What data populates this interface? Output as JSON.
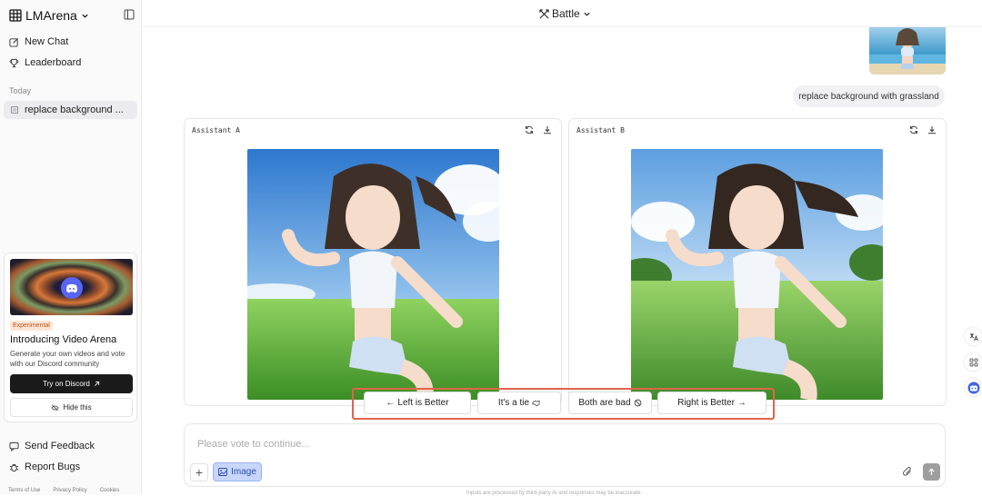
{
  "sidebar": {
    "brand": "LMArena",
    "nav": [
      {
        "label": "New Chat",
        "icon": "edit-icon"
      },
      {
        "label": "Leaderboard",
        "icon": "trophy-icon"
      }
    ],
    "section_today": "Today",
    "chat_history": [
      {
        "label": "replace background ..."
      }
    ],
    "promo": {
      "tag": "Experimental",
      "title": "Introducing Video Arena",
      "description": "Generate your own videos and vote with our Discord community",
      "cta": "Try on Discord",
      "hide": "Hide this"
    },
    "bottom": [
      {
        "label": "Send Feedback",
        "icon": "feedback-icon"
      },
      {
        "label": "Report Bugs",
        "icon": "bug-icon"
      }
    ],
    "footer_links": [
      "Terms of Use",
      "Privacy Policy",
      "Cookies"
    ]
  },
  "header": {
    "mode": "Battle"
  },
  "conversation": {
    "user_message": "replace background with grassland",
    "assistant_a": {
      "label": "Assistant A"
    },
    "assistant_b": {
      "label": "Assistant B"
    }
  },
  "vote": {
    "left": "Left is Better",
    "tie": "It's a tie",
    "bad": "Both are bad",
    "right": "Right is Better"
  },
  "composer": {
    "placeholder": "Please vote to continue...",
    "image_label": "Image",
    "disclaimer": "Inputs are processed by third-party AI and responses may be inaccurate."
  },
  "colors": {
    "accent_frame": "#e0654a",
    "image_btn": "#c9d6fb",
    "discord": "#5865f2"
  }
}
